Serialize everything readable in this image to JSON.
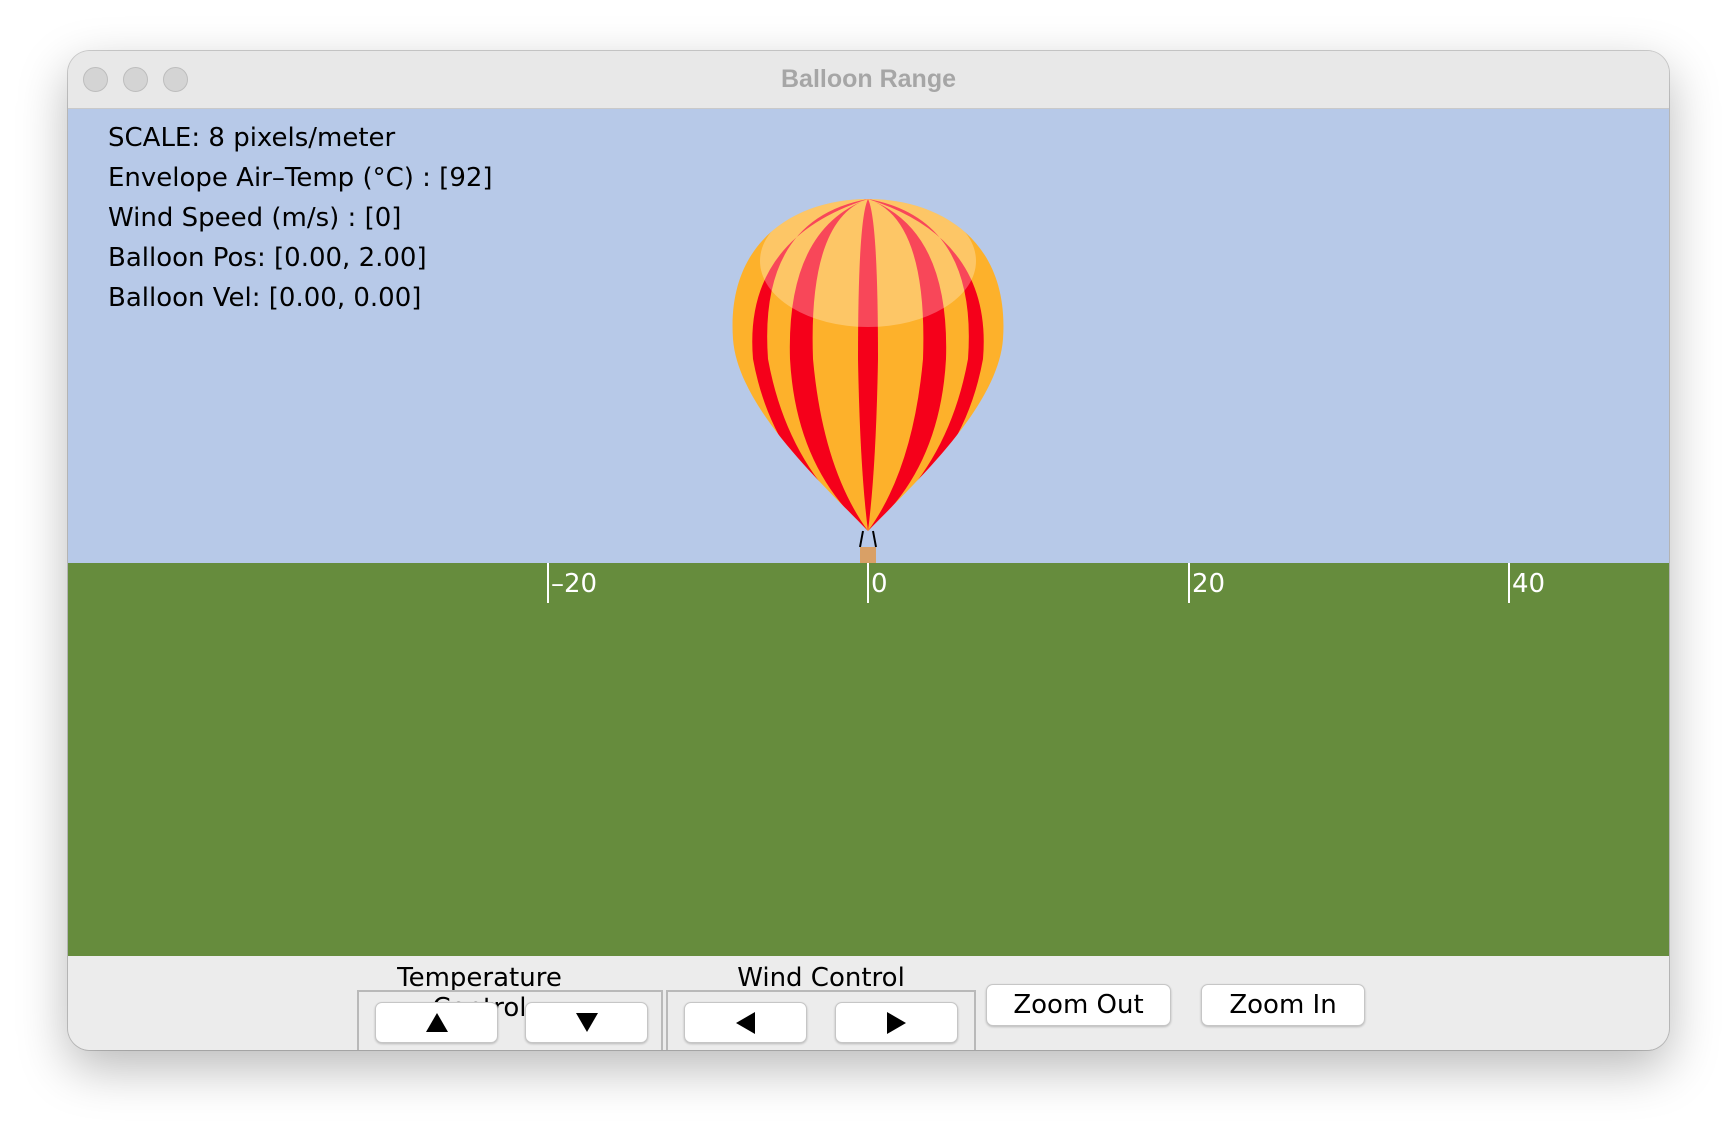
{
  "window": {
    "title": "Balloon Range",
    "traffic_lights": [
      "close-button",
      "minimize-button",
      "zoom-button"
    ]
  },
  "info": {
    "scale": "SCALE: 8 pixels/meter",
    "envelope_temp": "Envelope Air–Temp (°C) : [92]",
    "wind_speed": "Wind Speed (m/s) : [0]",
    "balloon_pos": "Balloon Pos: [0.00, 2.00]",
    "balloon_vel": "Balloon Vel: [0.00, 0.00]"
  },
  "ruler": {
    "ticks": [
      "–20",
      "0",
      "20",
      "40"
    ]
  },
  "colors": {
    "sky": "#b7c9e8",
    "ground": "#668c3d",
    "stripe_red": "#f5001a",
    "stripe_orange": "#fdb12b",
    "basket": "#d9a066"
  },
  "controls": {
    "temperature_label": "Temperature Control",
    "temp_up_icon": "arrow-up-icon",
    "temp_down_icon": "arrow-down-icon",
    "wind_label": "Wind Control",
    "wind_left_icon": "arrow-left-icon",
    "wind_right_icon": "arrow-right-icon",
    "zoom_out": "Zoom Out",
    "zoom_in": "Zoom In"
  }
}
